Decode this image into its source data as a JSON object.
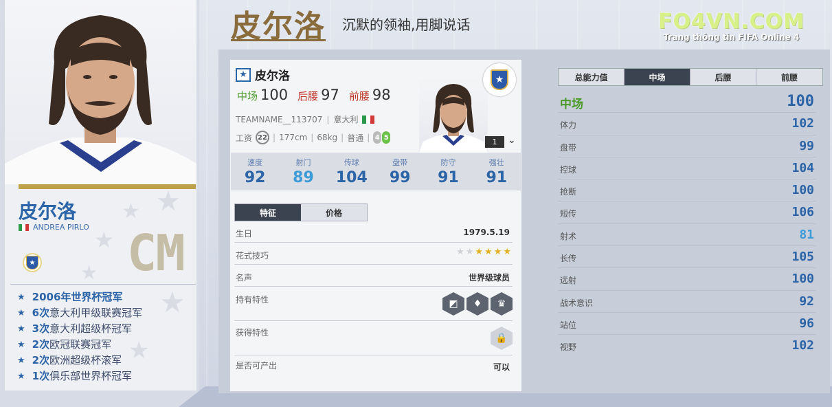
{
  "header": {
    "name": "皮尔洛",
    "subtitle": "沉默的领袖,用脚说话",
    "watermark_title": "FO4VN.COM",
    "watermark_sub": "Trang thông tin FIFA Online 4"
  },
  "left_card": {
    "name": "皮尔洛",
    "english_name": "ANDREA PIRLO",
    "position": "CM",
    "honors": [
      {
        "count": "",
        "title": "2006年世界杯冠军"
      },
      {
        "count": "6次",
        "title": "意大利甲级联赛冠军"
      },
      {
        "count": "3次",
        "title": "意大利超级杯冠军"
      },
      {
        "count": "2次",
        "title": "欧冠联赛冠军"
      },
      {
        "count": "2次",
        "title": "欧洲超级杯滚军"
      },
      {
        "count": "1次",
        "title": "俱乐部世界杯冠军"
      }
    ]
  },
  "player_card": {
    "name": "皮尔洛",
    "positions": [
      {
        "label": "中场",
        "value": "100"
      },
      {
        "label": "后腰",
        "value": "97"
      },
      {
        "label": "前腰",
        "value": "98"
      }
    ],
    "team": "TEAMNAME__113707",
    "nation": "意大利",
    "salary_label": "工资",
    "salary": "22",
    "height": "177cm",
    "weight": "68kg",
    "body_type": "普通",
    "weak_foot": "4",
    "strong_foot": "5",
    "level": "1",
    "stats": [
      {
        "label": "速度",
        "value": "92"
      },
      {
        "label": "射门",
        "value": "89"
      },
      {
        "label": "传球",
        "value": "104"
      },
      {
        "label": "盘带",
        "value": "99"
      },
      {
        "label": "防守",
        "value": "91"
      },
      {
        "label": "强壮",
        "value": "91"
      }
    ]
  },
  "detail_tabs": [
    "特征",
    "价格"
  ],
  "details": {
    "birthday_label": "生日",
    "birthday": "1979.5.19",
    "skill_label": "花式技巧",
    "skill_stars": 3,
    "skill_stars_max": 5,
    "reputation_label": "名声",
    "reputation": "世界级球员",
    "traits_label": "持有特性",
    "trait_icons": [
      "free-kick-icon",
      "tie-icon",
      "trophy-ball-icon"
    ],
    "acquired_label": "获得特性",
    "producible_label": "是否可产出",
    "producible": "可以"
  },
  "right_tabs": [
    "总能力值",
    "中场",
    "后腰",
    "前腰"
  ],
  "right_stats": {
    "head": {
      "label": "中场",
      "value": "100"
    },
    "rows": [
      {
        "label": "体力",
        "value": "102"
      },
      {
        "label": "盘带",
        "value": "99"
      },
      {
        "label": "控球",
        "value": "104"
      },
      {
        "label": "抢断",
        "value": "100"
      },
      {
        "label": "短传",
        "value": "106"
      },
      {
        "label": "射术",
        "value": "81"
      },
      {
        "label": "长传",
        "value": "105"
      },
      {
        "label": "远射",
        "value": "100"
      },
      {
        "label": "战术意识",
        "value": "92"
      },
      {
        "label": "站位",
        "value": "96"
      },
      {
        "label": "视野",
        "value": "102"
      }
    ]
  },
  "colors": {
    "accent_blue": "#2c64a8",
    "light_blue": "#3d9bd8",
    "green": "#4c9a2a",
    "gold": "#c0a04a",
    "brown_title": "#8a6b3c"
  }
}
